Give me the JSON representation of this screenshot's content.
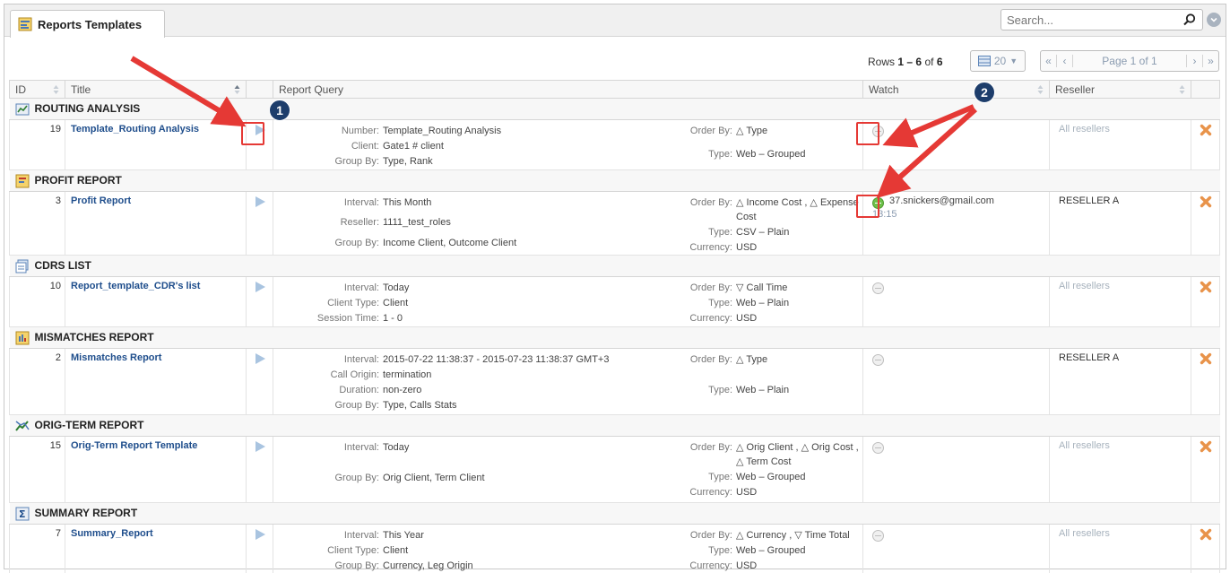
{
  "tab": {
    "title": "Reports Templates"
  },
  "search": {
    "placeholder": "Search..."
  },
  "pager": {
    "rows_prefix": "Rows",
    "rows_from": "1",
    "rows_sep": "–",
    "rows_to": "6",
    "rows_of": "of",
    "rows_total": "6",
    "per_page": "20",
    "first": "«",
    "prev": "‹",
    "page_label": "Page 1 of 1",
    "next": "›",
    "last": "»"
  },
  "columns": {
    "id": "ID",
    "title": "Title",
    "query": "Report Query",
    "watch": "Watch",
    "reseller": "Reseller"
  },
  "groups": [
    {
      "name": "ROUTING ANALYSIS",
      "icon": "routing-analysis-icon",
      "id": "19",
      "title": "Template_Routing Analysis",
      "left": [
        {
          "label": "Number:",
          "value": "Template_Routing Analysis"
        },
        {
          "label": "Client:",
          "value": "Gate1 # client"
        },
        {
          "label": "Group By:",
          "value": "Type, Rank"
        }
      ],
      "right": [
        {
          "label": "Order By:",
          "value": "△ Type"
        },
        {
          "label": "Type:",
          "value": "Web – Grouped"
        }
      ],
      "watch": false,
      "watcher": "",
      "watch_time": "",
      "reseller": "All resellers"
    },
    {
      "name": "PROFIT REPORT",
      "icon": "profit-report-icon",
      "id": "3",
      "title": "Profit Report",
      "left": [
        {
          "label": "Interval:",
          "value": "This Month"
        },
        {
          "label": "Reseller:",
          "value": "1111_test_roles"
        },
        {
          "label": "Group By:",
          "value": "Income Client, Outcome Client"
        }
      ],
      "right": [
        {
          "label": "Order By:",
          "value": "△ Income Cost , △ Expense Cost"
        },
        {
          "label": "Type:",
          "value": "CSV – Plain"
        },
        {
          "label": "Currency:",
          "value": "USD"
        }
      ],
      "watch": true,
      "watcher": "37.snickers@gmail.com",
      "watch_time": "13:15",
      "reseller": "RESELLER A"
    },
    {
      "name": "CDRS LIST",
      "icon": "cdrs-list-icon",
      "id": "10",
      "title": "Report_template_CDR's list",
      "left": [
        {
          "label": "Interval:",
          "value": "Today"
        },
        {
          "label": "Client Type:",
          "value": "Client"
        },
        {
          "label": "Session Time:",
          "value": "1 - 0"
        }
      ],
      "right": [
        {
          "label": "Order By:",
          "value": "▽ Call Time"
        },
        {
          "label": "Type:",
          "value": "Web – Plain"
        },
        {
          "label": "Currency:",
          "value": "USD"
        }
      ],
      "watch": false,
      "watcher": "",
      "watch_time": "",
      "reseller": "All resellers"
    },
    {
      "name": "MISMATCHES REPORT",
      "icon": "mismatches-report-icon",
      "id": "2",
      "title": "Mismatches Report",
      "left": [
        {
          "label": "Interval:",
          "value": "2015-07-22 11:38:37 - 2015-07-23 11:38:37 GMT+3"
        },
        {
          "label": "Call Origin:",
          "value": "termination"
        },
        {
          "label": "Duration:",
          "value": "non-zero"
        },
        {
          "label": "Group By:",
          "value": "Type, Calls Stats"
        }
      ],
      "right": [
        {
          "label": "Order By:",
          "value": "△ Type"
        },
        {
          "label": "Type:",
          "value": "Web – Plain"
        }
      ],
      "watch": false,
      "watcher": "",
      "watch_time": "",
      "reseller": "RESELLER A"
    },
    {
      "name": "ORIG-TERM REPORT",
      "icon": "orig-term-report-icon",
      "id": "15",
      "title": "Orig-Term Report Template",
      "left": [
        {
          "label": "Interval:",
          "value": "Today"
        },
        {
          "label": "Group By:",
          "value": "Orig Client, Term Client"
        }
      ],
      "right": [
        {
          "label": "Order By:",
          "value": "△ Orig Client , △ Orig Cost , △ Term Cost"
        },
        {
          "label": "Type:",
          "value": "Web – Grouped"
        },
        {
          "label": "Currency:",
          "value": "USD"
        }
      ],
      "watch": false,
      "watcher": "",
      "watch_time": "",
      "reseller": "All resellers"
    },
    {
      "name": "SUMMARY REPORT",
      "icon": "summary-report-icon",
      "id": "7",
      "title": "Summary_Report",
      "left": [
        {
          "label": "Interval:",
          "value": "This Year"
        },
        {
          "label": "Client Type:",
          "value": "Client"
        },
        {
          "label": "Group By:",
          "value": "Currency, Leg Origin"
        }
      ],
      "right": [
        {
          "label": "Order By:",
          "value": "△ Currency , ▽ Time Total"
        },
        {
          "label": "Type:",
          "value": "Web – Grouped"
        },
        {
          "label": "Currency:",
          "value": "USD"
        }
      ],
      "watch": false,
      "watcher": "",
      "watch_time": "",
      "reseller": "All resellers"
    }
  ],
  "annotations": {
    "badge1": "1",
    "badge2": "2"
  },
  "colors": {
    "accent": "#1f4e8c",
    "annotation": "#e53935",
    "watch_on": "#6dc04a",
    "delete": "#e8934a"
  }
}
